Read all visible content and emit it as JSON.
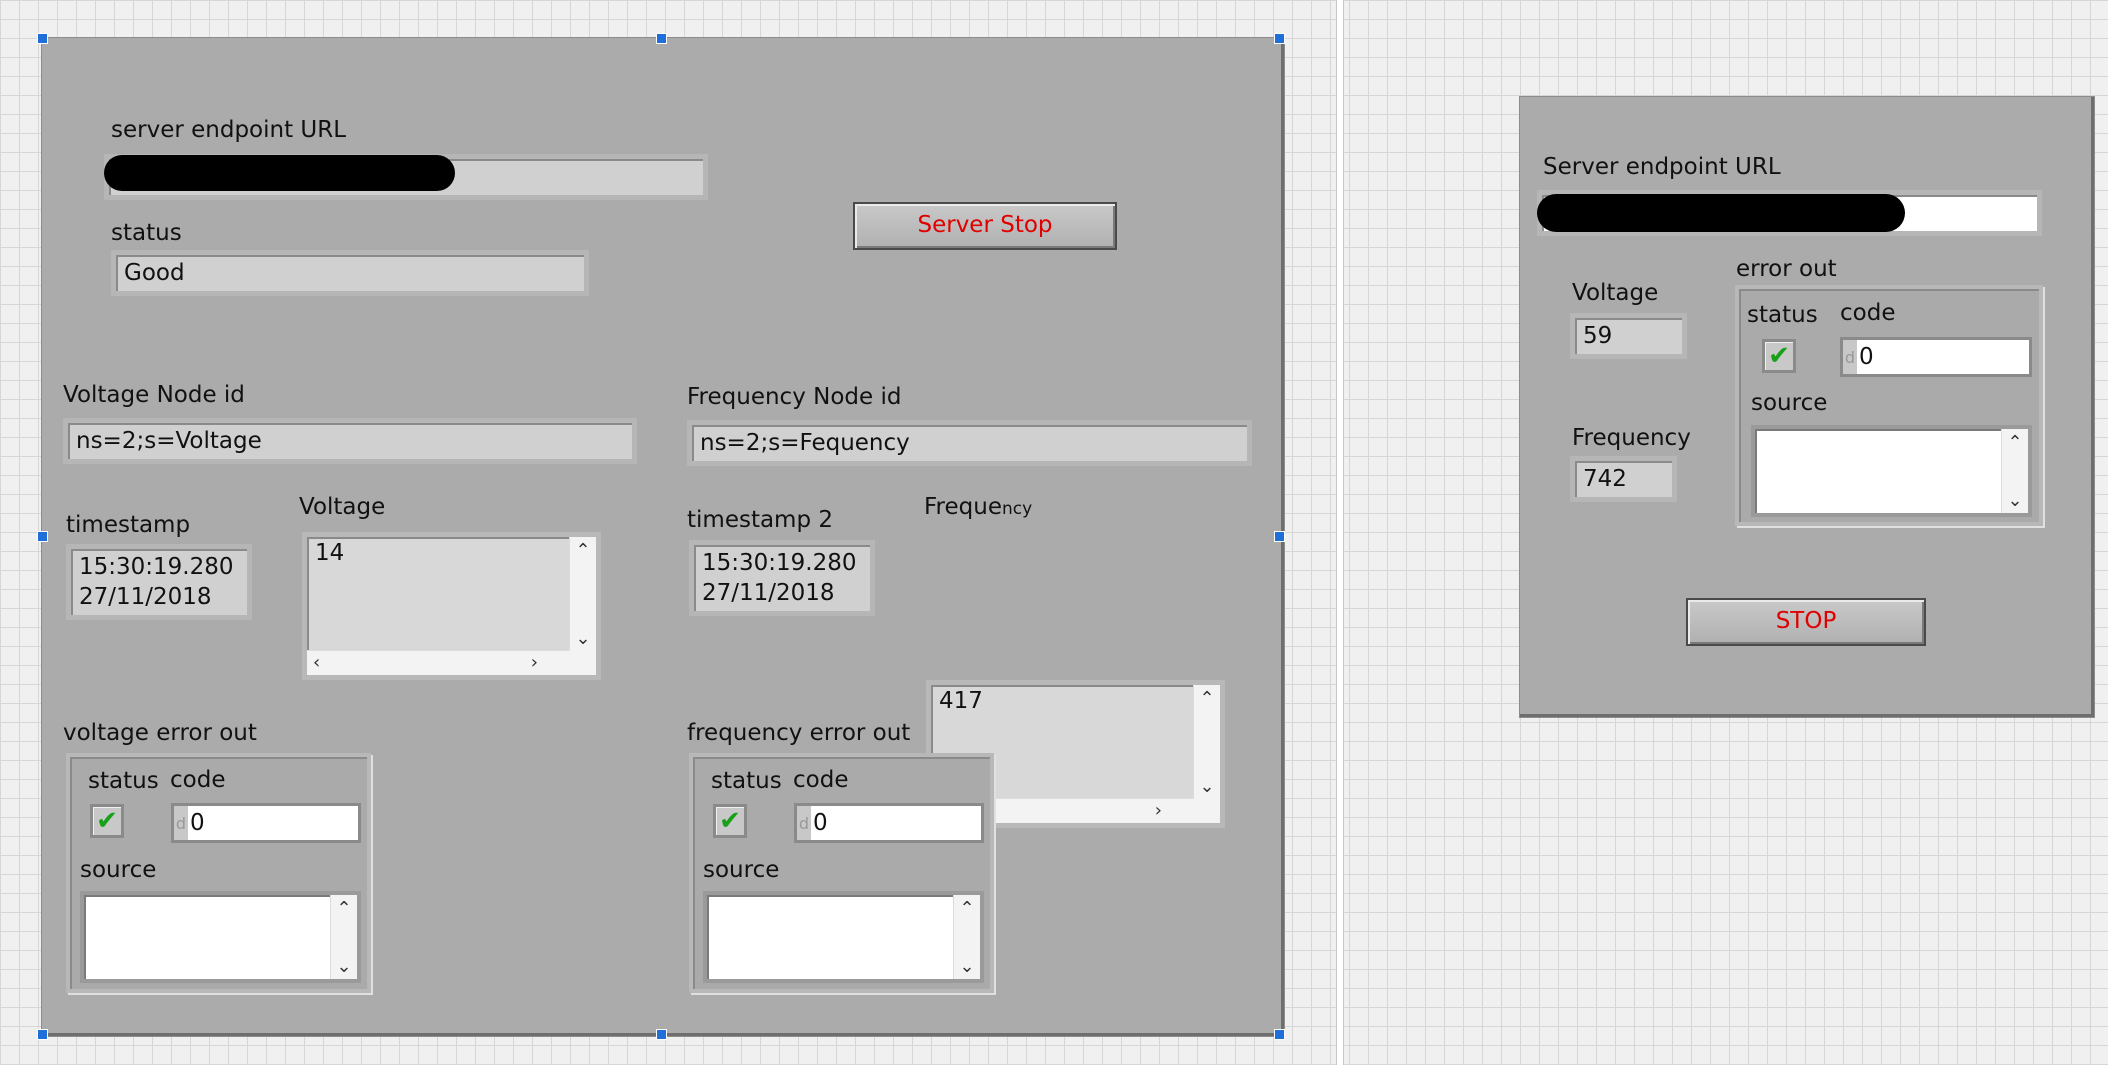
{
  "left_panel": {
    "server_url": {
      "label": "server endpoint URL"
    },
    "status": {
      "label": "status",
      "value": "Good"
    },
    "server_stop_button": {
      "label": "Server Stop"
    },
    "voltage_node": {
      "label": "Voltage Node id",
      "value": "ns=2;s=Voltage"
    },
    "frequency_node": {
      "label": "Frequency Node id",
      "value": "ns=2;s=Fequency"
    },
    "timestamp": {
      "label": "timestamp",
      "line1": "15:30:19.280",
      "line2": "27/11/2018"
    },
    "voltage": {
      "label": "Voltage",
      "value": "14"
    },
    "timestamp2": {
      "label": "timestamp 2",
      "line1": "15:30:19.280",
      "line2": "27/11/2018"
    },
    "frequency": {
      "label_main": "Freque",
      "label_small": "ncy",
      "value": "417"
    },
    "voltage_error": {
      "label": "voltage error out",
      "status_label": "status",
      "code_label": "code",
      "code_value": "0",
      "source_label": "source",
      "radix": "d"
    },
    "frequency_error": {
      "label": "frequency error out",
      "status_label": "status",
      "code_label": "code",
      "code_value": "0",
      "source_label": "source",
      "radix": "d"
    }
  },
  "right_panel": {
    "server_url": {
      "label": "Server endpoint URL"
    },
    "voltage": {
      "label": "Voltage",
      "value": "59"
    },
    "frequency": {
      "label": "Frequency",
      "value": "742"
    },
    "error_out": {
      "label": "error out",
      "status_label": "status",
      "code_label": "code",
      "code_value": "0",
      "source_label": "source",
      "radix": "d"
    },
    "stop_button": {
      "label": "STOP"
    }
  },
  "icons": {
    "check": "✔",
    "up": "⌃",
    "down": "⌄",
    "left": "‹",
    "right": "›"
  },
  "colors": {
    "panel": "#ababab",
    "button_text": "#e00000",
    "check": "#18a018",
    "selection_handle": "#1e6fd9"
  }
}
